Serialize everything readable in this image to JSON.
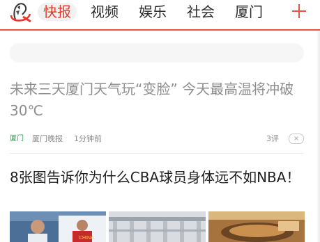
{
  "header": {
    "tabs": [
      {
        "label": "快报",
        "active": true
      },
      {
        "label": "视频",
        "active": false
      },
      {
        "label": "娱乐",
        "active": false
      },
      {
        "label": "社会",
        "active": false
      },
      {
        "label": "厦门",
        "active": false
      }
    ],
    "add_channel_icon": "plus-icon",
    "avatar_icon": "user-avatar-icon",
    "accent_color": "#e8382a"
  },
  "search": {
    "placeholder": ""
  },
  "feed": {
    "items": [
      {
        "title": "未来三天厦门天气玩“变脸” 今天最高温将冲破30℃",
        "tag": "厦门",
        "source": "厦门晚报",
        "time": "1分钟前",
        "comments": "3评",
        "dismiss_icon": "close-icon",
        "read": true
      },
      {
        "title": "8张图告诉你为什么CBA球员身体远不如NBA！",
        "thumbnails": [
          "basketball-players-photo",
          "basketball-player-jersey-photo",
          "metal-rack-photo"
        ]
      }
    ]
  },
  "colors": {
    "tag_green": "#2f9e52",
    "read_title_gray": "#8e8e8e",
    "title_dark": "#1f1f1f"
  }
}
